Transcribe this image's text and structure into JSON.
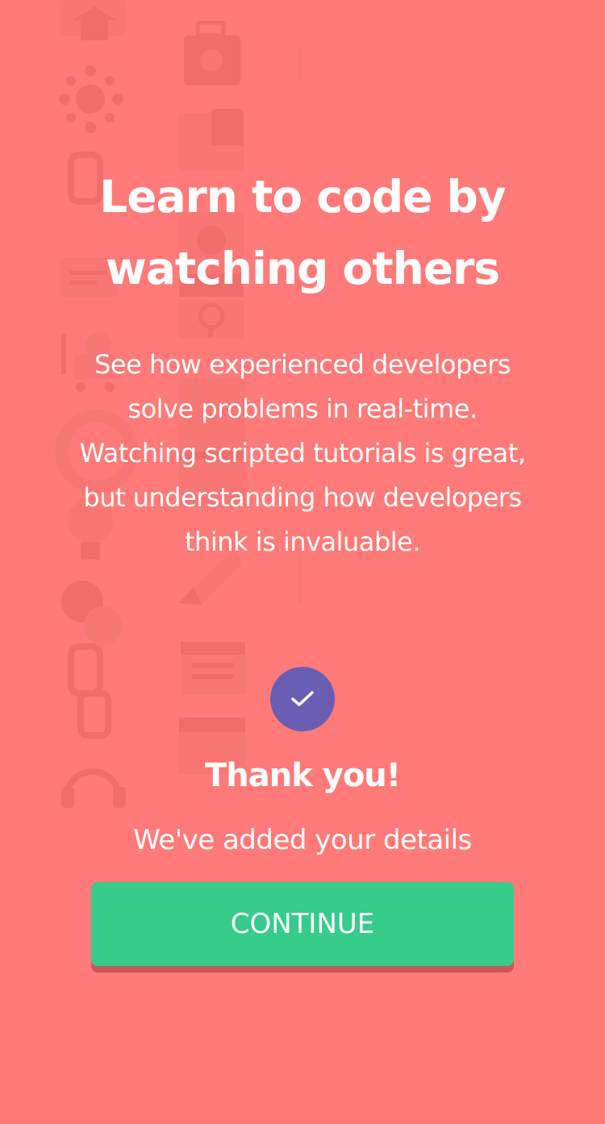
{
  "colors": {
    "background": "#ff7a78",
    "check_circle": "#6a5eb4",
    "button": "#36cc8b",
    "button_shadow": "#c9575a",
    "text": "#ffffff"
  },
  "hero": {
    "title_lines": [
      "Learn to code by",
      "watching others"
    ],
    "description_lines": [
      "See how experienced developers",
      "solve problems in real-time.",
      "Watching scripted tutorials is great,",
      "but understanding how developers",
      "think is invaluable."
    ]
  },
  "confirmation": {
    "icon": "checkmark-icon",
    "title": "Thank you!",
    "subtitle": "We've added your details",
    "button_label": "CONTINUE"
  },
  "background_icons": [
    "house-icon",
    "robot-icon",
    "network-icon",
    "folder-icon",
    "link-icon",
    "gear-icon",
    "chat-icon",
    "browser-window-icon",
    "magnifier-icon",
    "cart-icon",
    "lifebuoy-icon",
    "lightbulb-icon",
    "rocket-icon",
    "speech-bubbles-icon",
    "calendar-icon",
    "headphones-icon"
  ]
}
